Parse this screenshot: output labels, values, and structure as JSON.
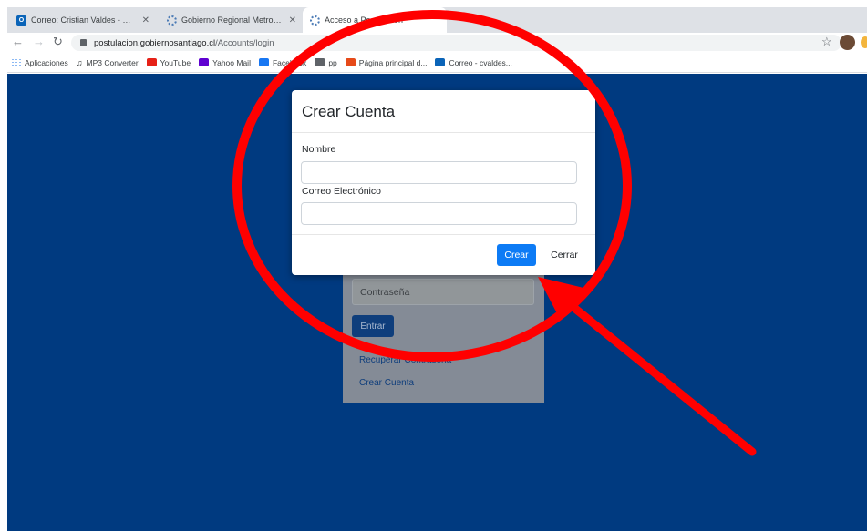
{
  "browser": {
    "tabs": [
      {
        "title": "Correo: Cristian Valdes - Outlo",
        "favicon": "outlook-icon"
      },
      {
        "title": "Gobierno Regional Metropolita",
        "favicon": "gobierno-icon"
      },
      {
        "title": "Acceso a Postulación",
        "favicon": "gobierno-icon"
      }
    ],
    "url_domain": "postulacion.gobiernosantiago.cl",
    "url_path": "/Accounts/login",
    "bookmarks": [
      {
        "label": "Aplicaciones",
        "icon": "apps-grid-icon"
      },
      {
        "label": "MP3 Converter",
        "icon": "music-icon"
      },
      {
        "label": "YouTube",
        "icon": "youtube-icon"
      },
      {
        "label": "Yahoo Mail",
        "icon": "yahoo-icon"
      },
      {
        "label": "Facebook",
        "icon": "facebook-icon"
      },
      {
        "label": "pp",
        "icon": "folder-icon"
      },
      {
        "label": "Página principal d...",
        "icon": "office-icon"
      },
      {
        "label": "Correo - cvaldes...",
        "icon": "outlook-icon"
      }
    ]
  },
  "login": {
    "password_placeholder": "Contraseña",
    "submit_label": "Entrar",
    "recover_link": "Recuperar Contraseña",
    "create_link": "Crear Cuenta"
  },
  "modal": {
    "title": "Crear Cuenta",
    "name_label": "Nombre",
    "name_value": "",
    "email_label": "Correo Electrónico",
    "email_value": "",
    "create_button": "Crear",
    "close_button": "Cerrar"
  },
  "colors": {
    "page_background": "#003a80",
    "primary_button": "#0d7bf5",
    "annotation": "#ff0000"
  }
}
